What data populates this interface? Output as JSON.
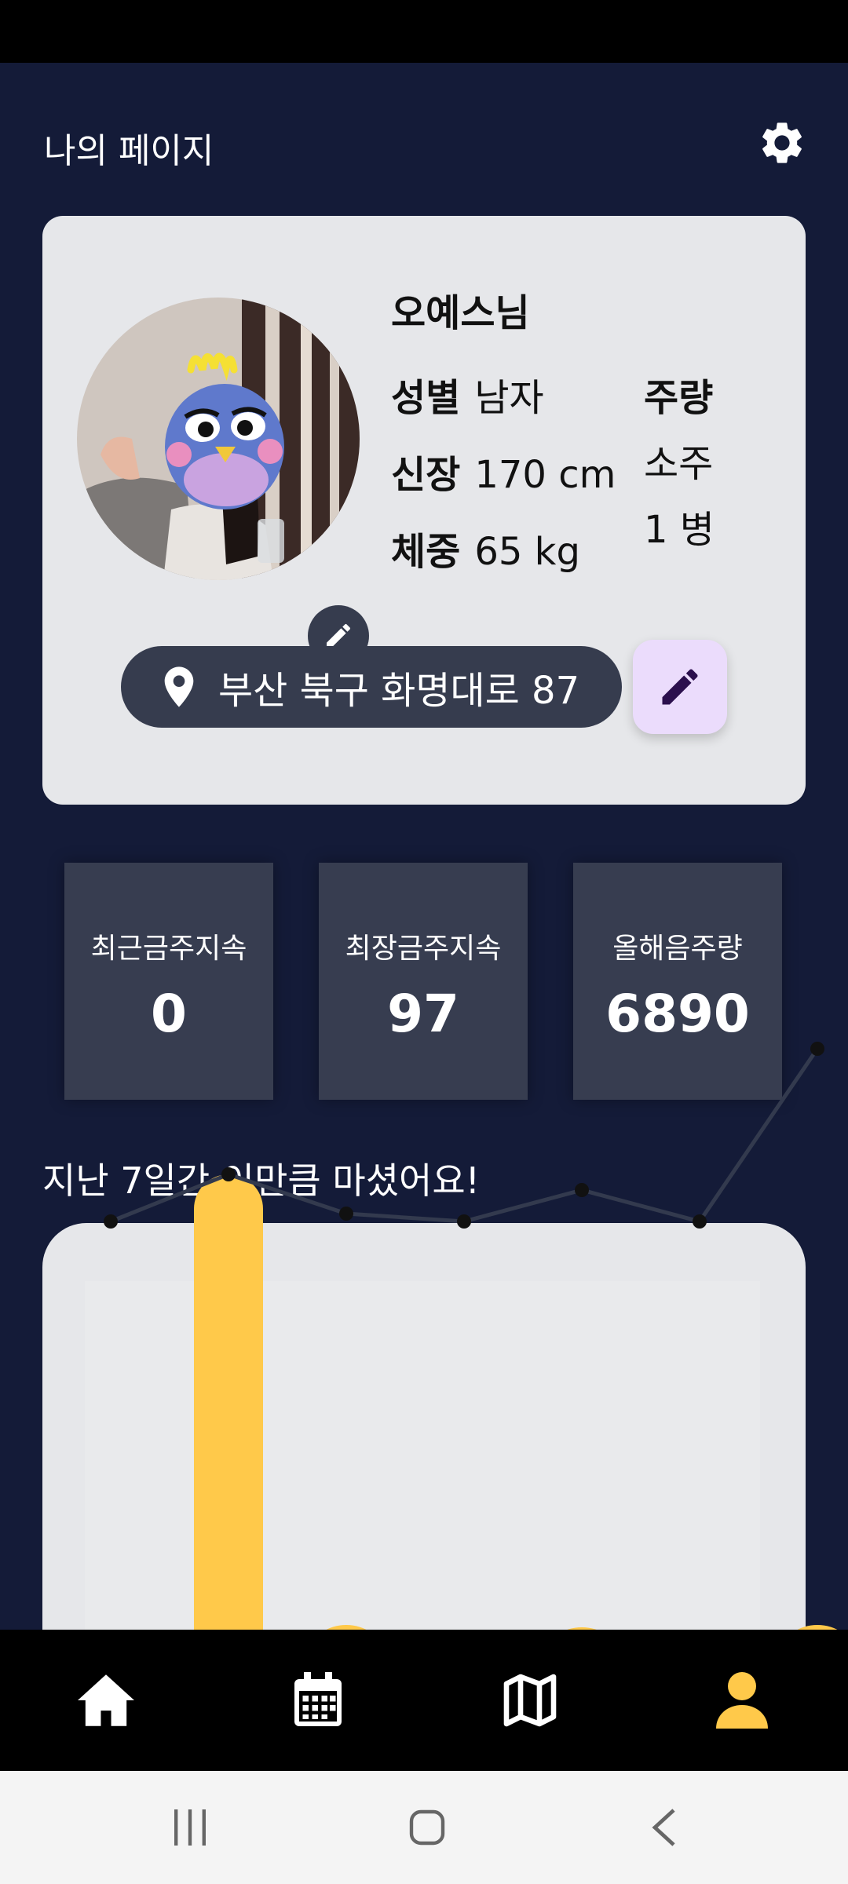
{
  "header": {
    "title": "나의 페이지"
  },
  "profile": {
    "nickname": "오예스님",
    "gender_label": "성별",
    "gender": "남자",
    "height_label": "신장",
    "height": "170 cm",
    "weight_label": "체중",
    "weight": "65 kg",
    "drink_label": "주량",
    "drink_type": "소주",
    "drink_amount": "1 병",
    "location": "부산 북구 화명대로 87"
  },
  "stats": [
    {
      "label": "최근금주지속",
      "value": "0"
    },
    {
      "label": "최장금주지속",
      "value": "97"
    },
    {
      "label": "올해음주량",
      "value": "6890"
    }
  ],
  "chart_title": "지난 7일간 이만큼 마셨어요!",
  "chart_data": {
    "type": "bar",
    "categories": [
      "",
      "",
      "",
      "",
      "",
      "",
      ""
    ],
    "series": [
      {
        "type": "line",
        "values": [
          52,
          58,
          53,
          52,
          56,
          52,
          74
        ]
      },
      {
        "type": "bar",
        "values": [
          null,
          58,
          0.6,
          null,
          0.3,
          null,
          0.6
        ]
      }
    ],
    "colors": {
      "line": "#333a4e",
      "bar": "#ffc94a"
    }
  },
  "nav": [
    {
      "icon": "home-icon",
      "active": false
    },
    {
      "icon": "calendar-icon",
      "active": false
    },
    {
      "icon": "map-icon",
      "active": false
    },
    {
      "icon": "person-icon",
      "active": true
    }
  ],
  "colors": {
    "background": "#141b38",
    "accent": "#ffc94a",
    "card": "#e6e7ea",
    "dark_card": "#373d50"
  }
}
